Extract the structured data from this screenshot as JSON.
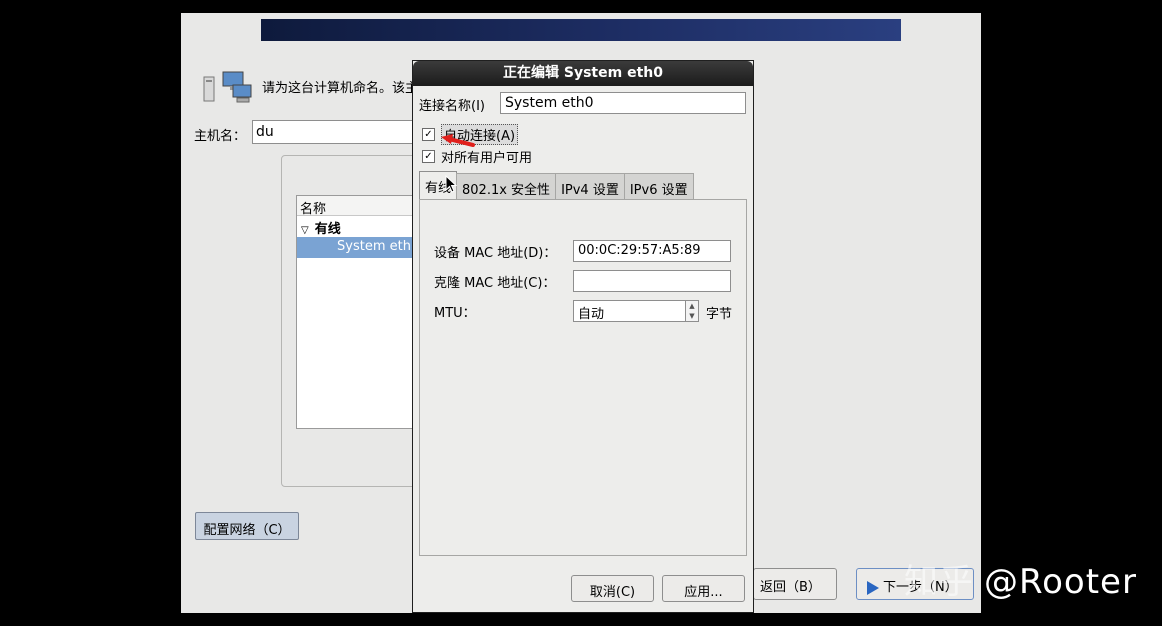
{
  "installer": {
    "prompt_text": "请为这台计算机命名。该主",
    "hostname_label": "主机名：",
    "hostname_value": "du",
    "network_tree": {
      "column_header": "名称",
      "group_label": "有线",
      "connection_item": "System eth"
    },
    "config_network_button": "配置网络（C）",
    "back_button": "返回（B）",
    "next_button": "下一步（N）"
  },
  "dialog": {
    "title": "正在编辑 System eth0",
    "connection_name_label": "连接名称(I)",
    "connection_name_value": "System eth0",
    "auto_connect_label": "自动连接(A)",
    "auto_connect_checked": true,
    "all_users_label": "对所有用户可用",
    "all_users_checked": true,
    "tabs": [
      {
        "label": "有线",
        "active": true
      },
      {
        "label": "802.1x 安全性",
        "active": false
      },
      {
        "label": "IPv4 设置",
        "active": false
      },
      {
        "label": "IPv6 设置",
        "active": false
      }
    ],
    "wired": {
      "device_mac_label": "设备 MAC 地址(D)：",
      "device_mac_value": "00:0C:29:57:A5:89",
      "clone_mac_label": "克隆 MAC 地址(C)：",
      "clone_mac_value": "",
      "mtu_label": "MTU：",
      "mtu_value": "自动",
      "mtu_unit": "字节"
    },
    "cancel_button": "取消(C)",
    "apply_button": "应用..."
  },
  "watermark": {
    "logo": "知乎",
    "text": "@Rooter"
  },
  "colors": {
    "banner": "#1d2d63",
    "selection": "#7aa3d3",
    "annotation_arrow": "#e0201c"
  }
}
